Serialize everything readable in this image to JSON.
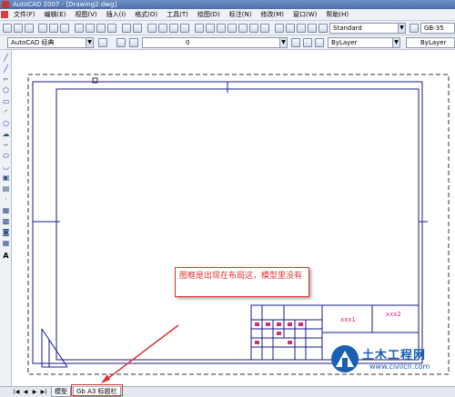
{
  "window": {
    "title": "AutoCAD 2007 - [Drawing2.dwg]"
  },
  "menu": [
    "文件(F)",
    "编辑(E)",
    "视图(V)",
    "插入(I)",
    "格式(O)",
    "工具(T)",
    "绘图(D)",
    "标注(N)",
    "修改(M)",
    "窗口(W)",
    "帮助(H)"
  ],
  "toolbar": {
    "text_style": "Standard",
    "dim_style": "GB-35"
  },
  "properties": {
    "workspace": "AutoCAD 经典",
    "layer": "0",
    "color": "ByLayer",
    "linetype": "ByLayer"
  },
  "layout_tabs": [
    "模型",
    "Gb A3 标题栏"
  ],
  "title_block": {
    "cell_left": "xxx1",
    "cell_right": "xxx2"
  },
  "callout": {
    "text": "图框是出现在布局这，模型里没有"
  },
  "watermark": {
    "name": "土木工程网",
    "url": "www.civilcn.com"
  },
  "icons": [
    "autocad-app-icon",
    "drawing-doc-icon",
    "line-icon",
    "circle-icon",
    "arc-icon",
    "rectangle-icon",
    "hatch-icon",
    "text-icon"
  ],
  "colors": {
    "titlebar": "#4a6ea8",
    "annotation": "#e03030",
    "drawing_lines": "#1a1a8c",
    "watermark": "#1a60b0"
  }
}
